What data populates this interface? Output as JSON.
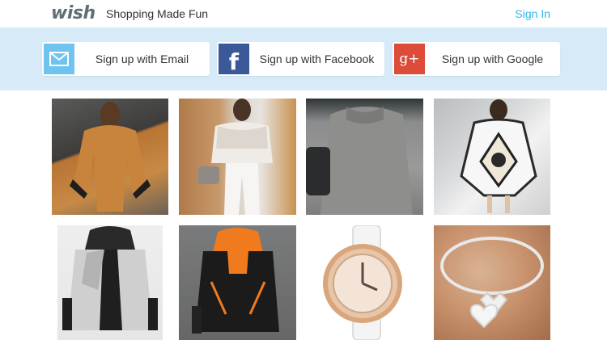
{
  "header": {
    "logo": "wish",
    "tagline": "Shopping Made Fun",
    "signin_label": "Sign In"
  },
  "signup": {
    "email_label": "Sign up with Email",
    "facebook_label": "Sign up with Facebook",
    "google_label": "Sign up with Google",
    "facebook_icon_text": "f",
    "google_icon_text": "g+"
  },
  "colors": {
    "accent": "#2fb7ec",
    "band": "#d6eaf8",
    "email": "#6fc3ef",
    "facebook": "#3b5998",
    "google": "#dd4b39"
  },
  "products": [
    {
      "icon": "orange-batwing-sweater"
    },
    {
      "icon": "lace-top-jeans-outfit"
    },
    {
      "icon": "gray-sweater"
    },
    {
      "icon": "white-tunic-dress"
    },
    {
      "icon": "gray-hoodie-jacket"
    },
    {
      "icon": "black-orange-hoodie"
    },
    {
      "icon": "rose-gold-watch"
    },
    {
      "icon": "silver-heart-bracelet"
    }
  ]
}
